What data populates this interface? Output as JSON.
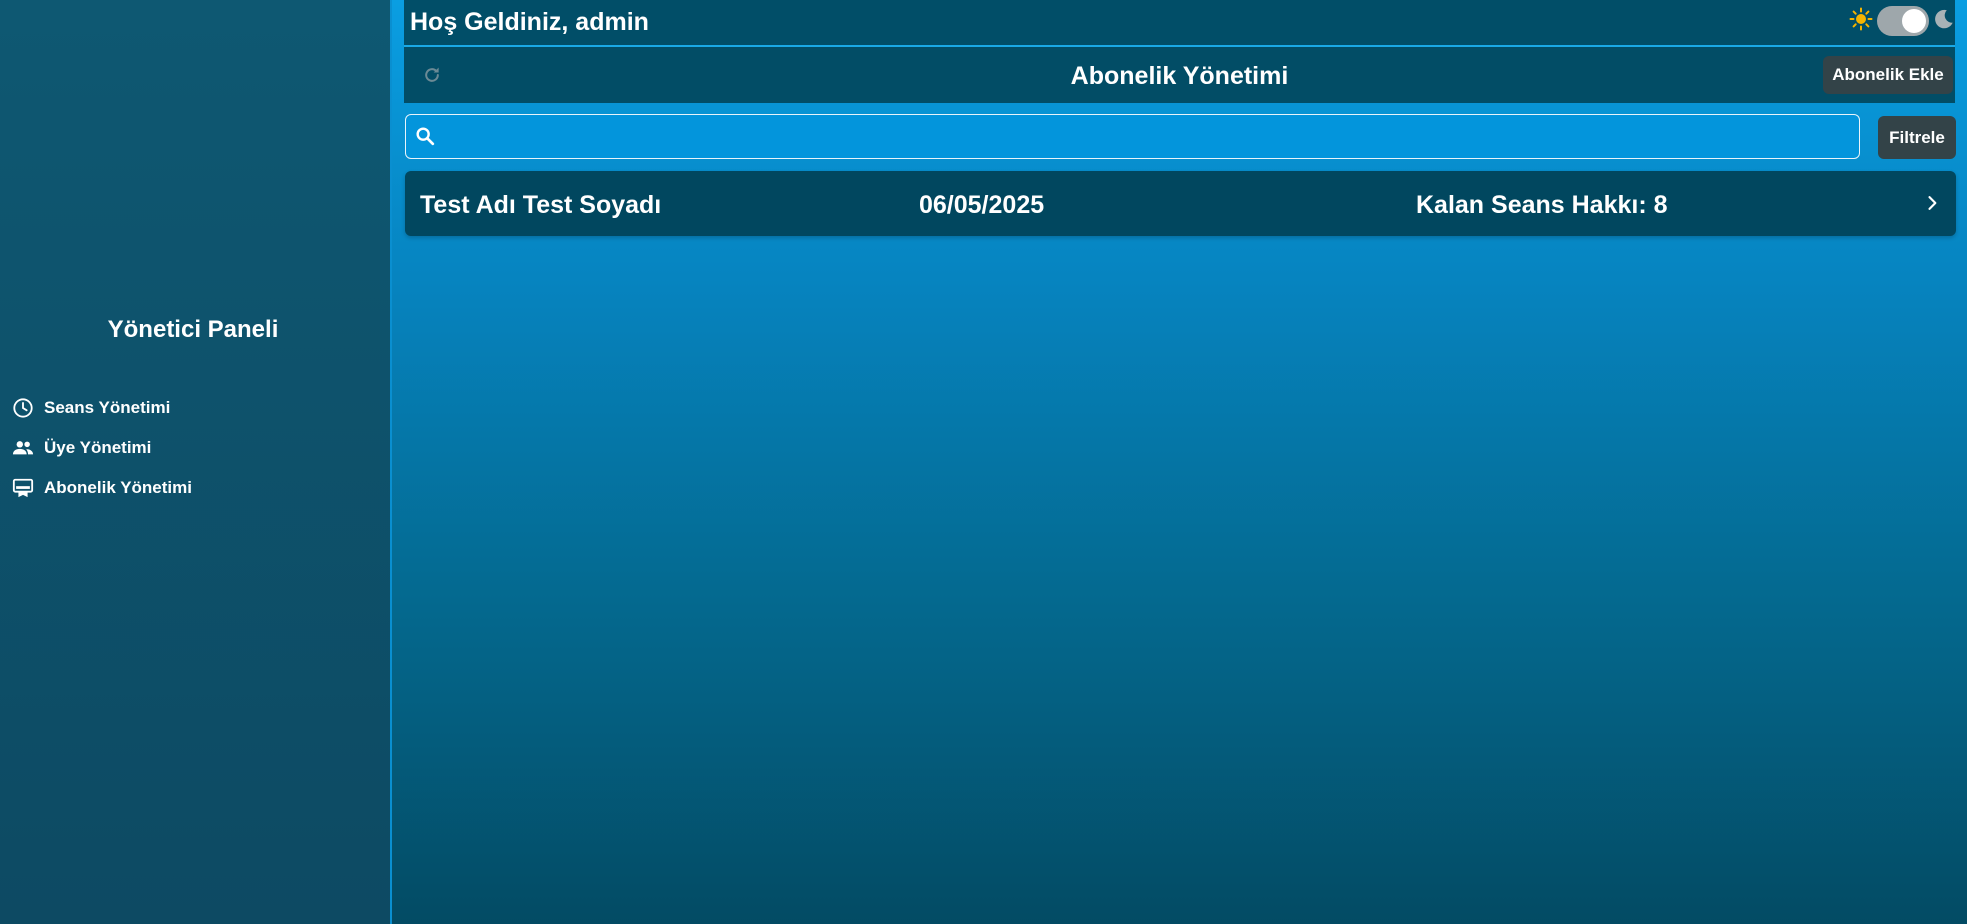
{
  "sidebar": {
    "title": "Yönetici Paneli",
    "items": [
      {
        "label": "Seans Yönetimi",
        "icon": "clock-icon"
      },
      {
        "label": "Üye Yönetimi",
        "icon": "people-icon"
      },
      {
        "label": "Abonelik Yönetimi",
        "icon": "subscription-icon"
      }
    ]
  },
  "topbar": {
    "welcome": "Hoş Geldiniz, admin",
    "theme_toggle": {
      "state": "light",
      "icons": [
        "sun-icon",
        "moon-icon"
      ]
    }
  },
  "header": {
    "title": "Abonelik Yönetimi",
    "add_button": "Abonelik Ekle",
    "refresh_icon": "refresh-icon"
  },
  "search": {
    "placeholder": "",
    "value": ""
  },
  "filter_button": "Filtrele",
  "subscriptions": [
    {
      "name": "Test Adı Test Soyadı",
      "date": "06/05/2025",
      "remaining": "Kalan Seans Hakkı: 8"
    }
  ],
  "colors": {
    "sidebar_bg": "#0e5872",
    "topbar_bg": "#014e68",
    "row_bg": "#01475f",
    "button_bg": "#334348",
    "accent": "#0a9ee2",
    "sun": "#f5b400"
  }
}
